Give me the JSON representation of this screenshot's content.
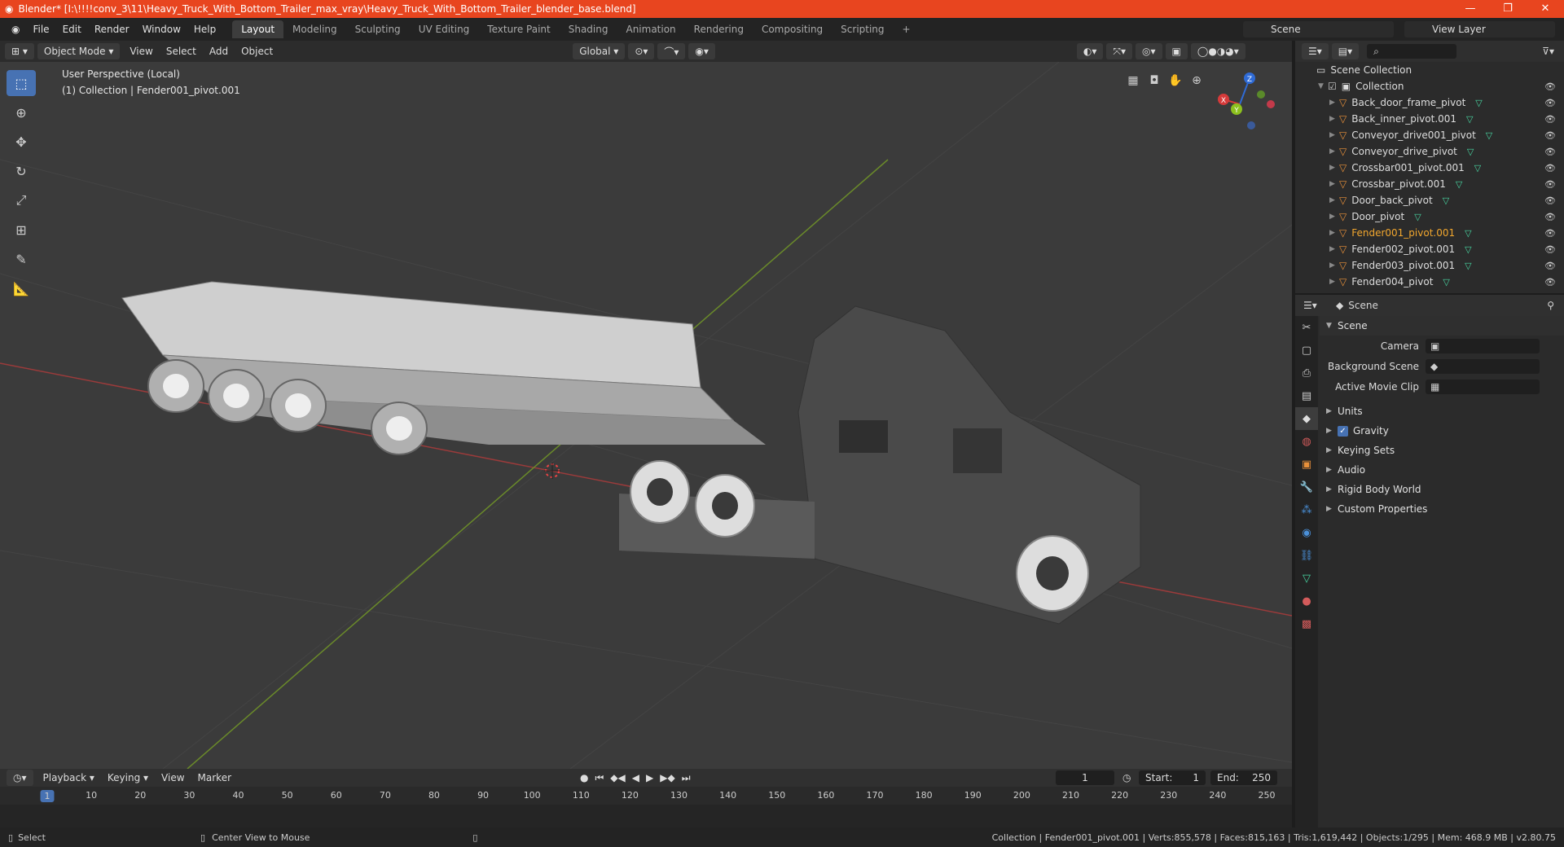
{
  "window": {
    "title": "Blender* [I:\\!!!!conv_3\\11\\Heavy_Truck_With_Bottom_Trailer_max_vray\\Heavy_Truck_With_Bottom_Trailer_blender_base.blend]",
    "controls": [
      "—",
      "❐",
      "✕"
    ]
  },
  "menu": [
    "File",
    "Edit",
    "Render",
    "Window",
    "Help"
  ],
  "workspaces": [
    "Layout",
    "Modeling",
    "Sculpting",
    "UV Editing",
    "Texture Paint",
    "Shading",
    "Animation",
    "Rendering",
    "Compositing",
    "Scripting",
    "+"
  ],
  "scene_selector": "Scene",
  "view_layer": "View Layer",
  "viewport_header": {
    "mode": "Object Mode",
    "menus": [
      "View",
      "Select",
      "Add",
      "Object"
    ],
    "orientation": "Global"
  },
  "viewport": {
    "perspective_label": "User Perspective (Local)",
    "collection_label": "(1) Collection | Fender001_pivot.001",
    "gizmo_axes": [
      "X",
      "Y",
      "Z"
    ]
  },
  "outliner": {
    "root": "Scene Collection",
    "collection": "Collection",
    "items": [
      {
        "name": "Back_door_frame_pivot",
        "selected": false
      },
      {
        "name": "Back_inner_pivot.001",
        "selected": false
      },
      {
        "name": "Conveyor_drive001_pivot",
        "selected": false
      },
      {
        "name": "Conveyor_drive_pivot",
        "selected": false
      },
      {
        "name": "Crossbar001_pivot.001",
        "selected": false
      },
      {
        "name": "Crossbar_pivot.001",
        "selected": false
      },
      {
        "name": "Door_back_pivot",
        "selected": false
      },
      {
        "name": "Door_pivot",
        "selected": false
      },
      {
        "name": "Fender001_pivot.001",
        "selected": true
      },
      {
        "name": "Fender002_pivot.001",
        "selected": false
      },
      {
        "name": "Fender003_pivot.001",
        "selected": false
      },
      {
        "name": "Fender004_pivot",
        "selected": false
      }
    ]
  },
  "properties": {
    "header": "Scene",
    "section": "Scene",
    "fields": [
      {
        "label": "Camera",
        "value": ""
      },
      {
        "label": "Background Scene",
        "value": ""
      },
      {
        "label": "Active Movie Clip",
        "value": ""
      }
    ],
    "subsections": [
      "Units",
      "Gravity",
      "Keying Sets",
      "Audio",
      "Rigid Body World",
      "Custom Properties"
    ]
  },
  "timeline": {
    "menus": [
      "Playback",
      "Keying",
      "View",
      "Marker"
    ],
    "current_frame": "1",
    "start_label": "Start:",
    "start": "1",
    "end_label": "End:",
    "end": "250",
    "ruler": [
      "1",
      "10",
      "20",
      "30",
      "40",
      "50",
      "60",
      "70",
      "80",
      "90",
      "100",
      "110",
      "120",
      "130",
      "140",
      "150",
      "160",
      "170",
      "180",
      "190",
      "200",
      "210",
      "220",
      "230",
      "240",
      "250"
    ]
  },
  "statusbar": {
    "left": "Select",
    "middle": "Center View to Mouse",
    "right": "Collection | Fender001_pivot.001 | Verts:855,578 | Faces:815,163 | Tris:1,619,442 | Objects:1/295 | Mem: 468.9 MB | v2.80.75"
  },
  "colors": {
    "accent": "#4772b3",
    "titlebar": "#e8451f",
    "selected": "#f2a72e"
  }
}
